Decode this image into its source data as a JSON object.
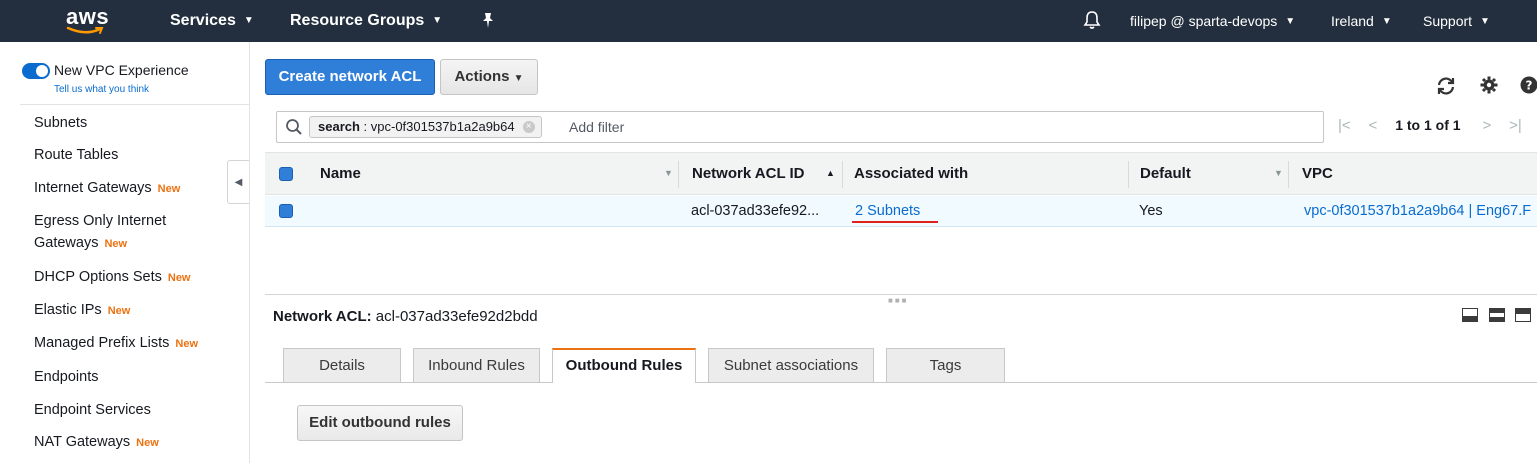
{
  "topnav": {
    "logo_text": "aws",
    "services": "Services",
    "resource_groups": "Resource Groups",
    "account": "filipep @ sparta-devops",
    "region": "Ireland",
    "support": "Support"
  },
  "sidebar": {
    "toggle_label": "New VPC Experience",
    "tell_us": "Tell us what you think",
    "new_badge": "New",
    "items": [
      {
        "label": "Subnets"
      },
      {
        "label": "Route Tables"
      },
      {
        "label": "Internet Gateways",
        "new": true
      },
      {
        "label": "Egress Only Internet",
        "label2": "Gateways",
        "new": true
      },
      {
        "label": "DHCP Options Sets",
        "new": true
      },
      {
        "label": "Elastic IPs",
        "new": true
      },
      {
        "label": "Managed Prefix Lists",
        "new": true
      },
      {
        "label": "Endpoints"
      },
      {
        "label": "Endpoint Services"
      },
      {
        "label": "NAT Gateways",
        "new": true
      }
    ]
  },
  "toolbar": {
    "create_label": "Create network ACL",
    "actions_label": "Actions"
  },
  "filter": {
    "chip_key": "search",
    "chip_value": " : vpc-0f301537b1a2a9b64",
    "add_filter_placeholder": "Add filter"
  },
  "pager": {
    "text": "1 to 1 of 1"
  },
  "table": {
    "columns": [
      "Name",
      "Network ACL ID",
      "Associated with",
      "Default",
      "VPC"
    ],
    "rows": [
      {
        "name": "",
        "acl_id": "acl-037ad33efe92...",
        "associated": "2 Subnets",
        "default": "Yes",
        "vpc": "vpc-0f301537b1a2a9b64 | Eng67.F"
      }
    ]
  },
  "detail": {
    "label": "Network ACL:",
    "value": "acl-037ad33efe92d2bdd",
    "tabs": [
      "Details",
      "Inbound Rules",
      "Outbound Rules",
      "Subnet associations",
      "Tags"
    ],
    "active_tab": "Outbound Rules",
    "edit_button": "Edit outbound rules"
  },
  "colors": {
    "nav_bg": "#232f3e",
    "primary": "#2f7ed8",
    "link": "#0a6ccf",
    "new_badge": "#ec7211"
  }
}
